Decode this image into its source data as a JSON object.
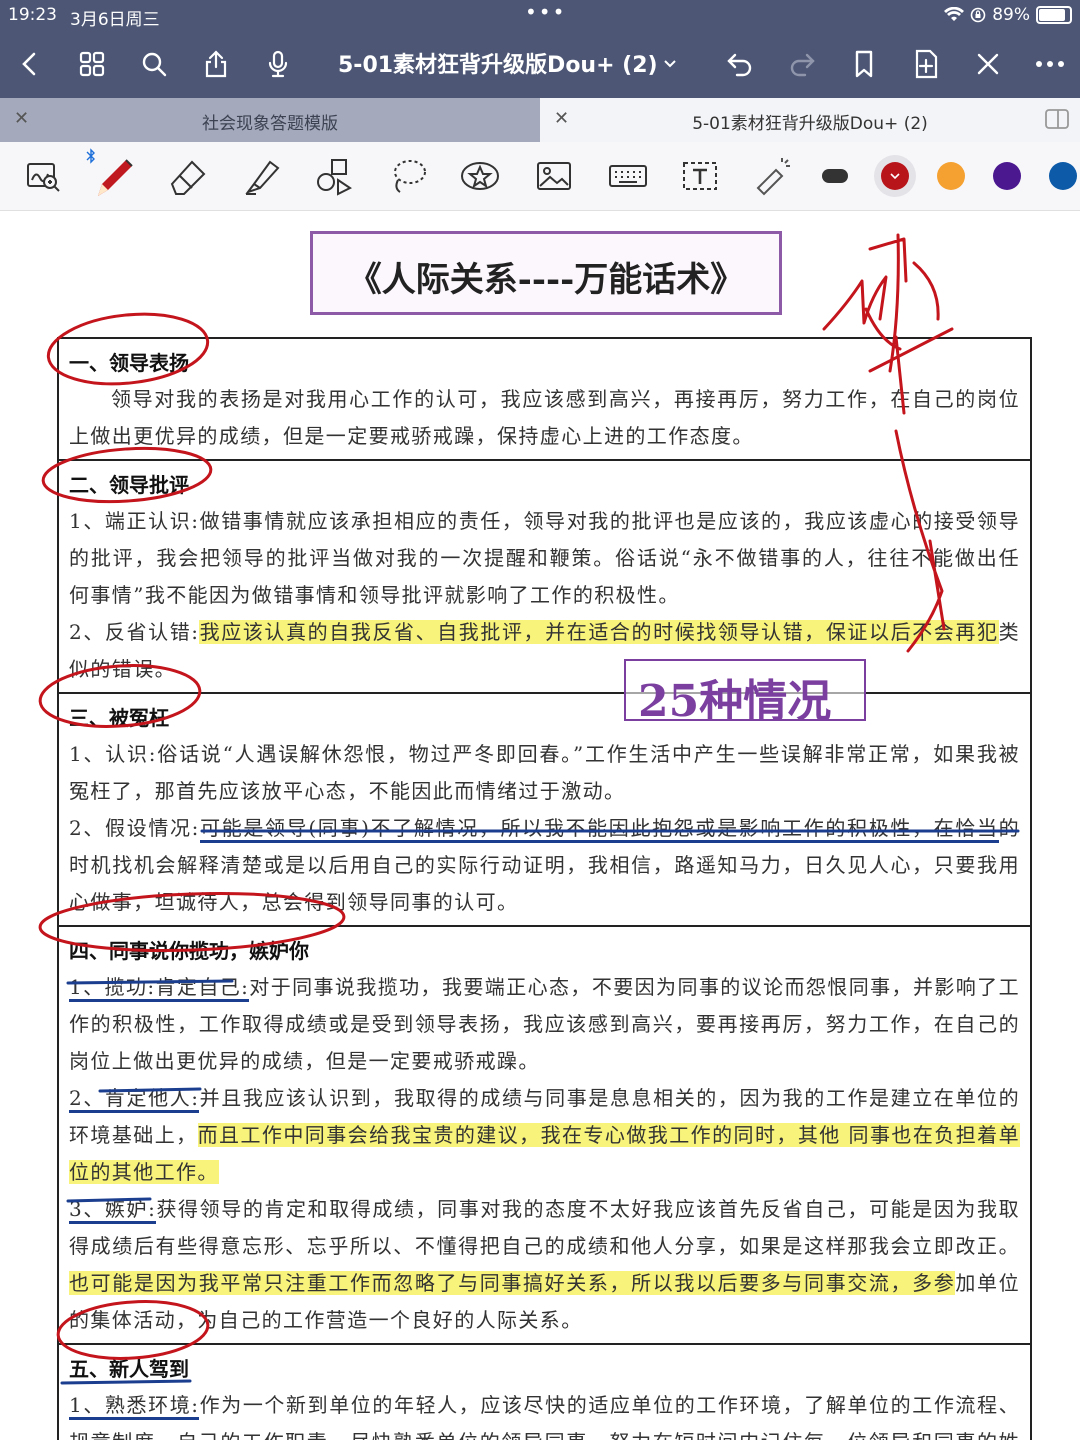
{
  "status": {
    "time": "19:23",
    "date": "3月6日周三",
    "battery": "89%",
    "battery_level": 0.89
  },
  "nav": {
    "title": "5-01素材狂背升级版Dou+ (2)"
  },
  "tabs": [
    {
      "label": "社会现象答题模版"
    },
    {
      "label": "5-01素材狂背升级版Dou+ (2)"
    }
  ],
  "colors": {
    "red": "#b8151b",
    "orange": "#f5a131",
    "purple": "#4b1890",
    "blue": "#0c5aa8",
    "black": "#333333"
  },
  "doc": {
    "title": "《人际关系----万能话术》",
    "stamp": "25种情况",
    "sections": [
      {
        "heading": "一、领导表扬",
        "paras": [
          {
            "a": "领导对我的表扬是对我用心工作的认可，我应该感到高兴，再接再厉，努力工作，在自己的岗位上做出更优异的成绩，但是一定要戒骄戒躁，保持虚心上进的工作态度。"
          }
        ]
      },
      {
        "heading": "二、领导批评",
        "paras": [
          {
            "a": "1、端正认识:做错事情就应该承担相应的责任，领导对我的批评也是应该的，我应该虚心的接受领导的批评，我会把领导的批评当做对我的一次提醒和鞭策。俗话说“永不做错事的人，往往不能做出任何事情”我不能因为做错事情和领导批评就影响了工作的积极性。"
          },
          {
            "a": "2、反省认错:",
            "b": "我应该认真的自我反省、自我批评，并在适合的时候找领导认错，保证以后不会再犯",
            "c": "类似的错误。"
          }
        ]
      },
      {
        "heading": "三、被冤枉",
        "paras": [
          {
            "a": "1、认识:俗话说“人遇误解休怨恨，物过严冬即回春。”工作生活中产生一些误解非常正常，如果我被冤枉了，那首先应该放平心态，不能因此而情绪过于激动。"
          },
          {
            "a": "2、假设情况:",
            "b": "可能是领导(同事)不了解情况，所以我不能因此抱怨或是影响工作的积极性，在恰当",
            "c": "的时机找机会解释清楚或是以后用自己的实际行动证明，我相信，路遥知马力，日久见人心，只要我用心做事，坦诚待人，总会得到领导同事的认可。"
          }
        ]
      },
      {
        "heading": "四、同事说你揽功，嫉妒你",
        "paras": [
          {
            "a": "1、揽功:肯定自己:",
            "b": "对于同事说我揽功，我要端正心态，不要因为同事的议论而怨恨同事，并影响了",
            "c": "工作的积极性，工作取得成绩或是受到领导表扬，我应该感到高兴，要再接再厉，努力工作，在自己的岗位上做出更优异的成绩，但是一定要戒骄戒躁。"
          },
          {
            "a": "2、肯定他人:",
            "b": "并且我应该认识到，我取得的成绩与同事是息息相关的，因为我的工作是建立在单位的环境基础上，",
            "c": "而且工作中同事会给我宝贵的建议，我在专心做我工作的同时，其他 同事也在负担着单位的其他工作。"
          },
          {
            "a": "3、嫉妒:",
            "b": "获得领导的肯定和取得成绩，同事对我的态度不太好我应该首先反省自己，可能是因为我取得成绩后有些得意忘形、忘乎所以、不懂得把自己的成绩和他人分享，如果是这样那我会立即改正。",
            "c": "也可能是因为我平常只注重工作而忽略了与同事搞好关系，所以我以后要多与同事交流，多参",
            "d": "加单位的集体活动，为自己的工作营造一个良好的人际关系。"
          }
        ]
      },
      {
        "heading": "五、新人驾到",
        "paras": [
          {
            "a": "1、熟悉环境:",
            "b": "作为一个新到单位的年轻人，应该尽快的适应单位的工作环境，了解单位的工作流程、规章制度、自己的工作职责、尽快熟悉单位的领导同事，努力在短时间内记住每一位领导和同事的姓名与职位，不仅是熟悉环境的基本要求，也是对他们的尊重。"
          }
        ]
      }
    ]
  }
}
